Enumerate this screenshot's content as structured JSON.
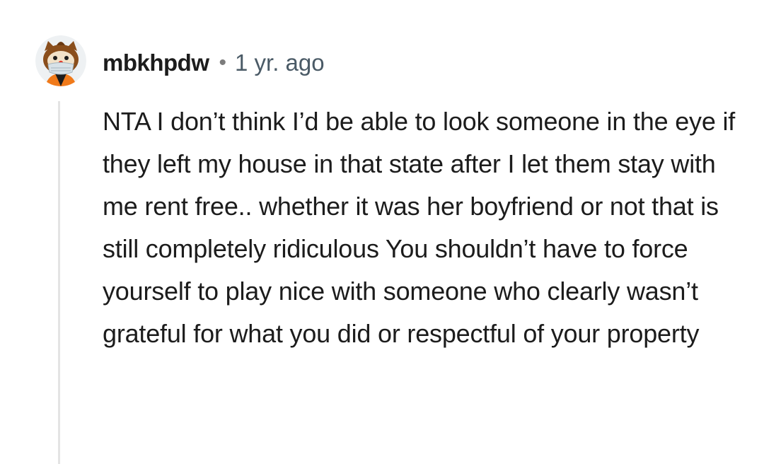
{
  "comment": {
    "author": "mbkhpdw",
    "separator": "•",
    "timestamp": "1 yr. ago",
    "body": "NTA I don’t think I’d be able to look someone in the eye if they left my house in that state after I let them stay with me rent free.. whether it was her boyfriend or not that is still completely ridiculous You shouldn’t have to force yourself to play nice with someone who clearly wasn’t grateful for what you did or respectful of your property"
  },
  "avatar": {
    "icon": "snoo-avatar-icon",
    "colors": {
      "fur": "#8a4e1c",
      "mask": "#d8e2e8",
      "nose": "#e23b2e",
      "shirt": "#f07a1a"
    }
  },
  "colors": {
    "text": "#1c1c1c",
    "meta": "#4a5a66",
    "thread_line": "#e4e4e4"
  }
}
